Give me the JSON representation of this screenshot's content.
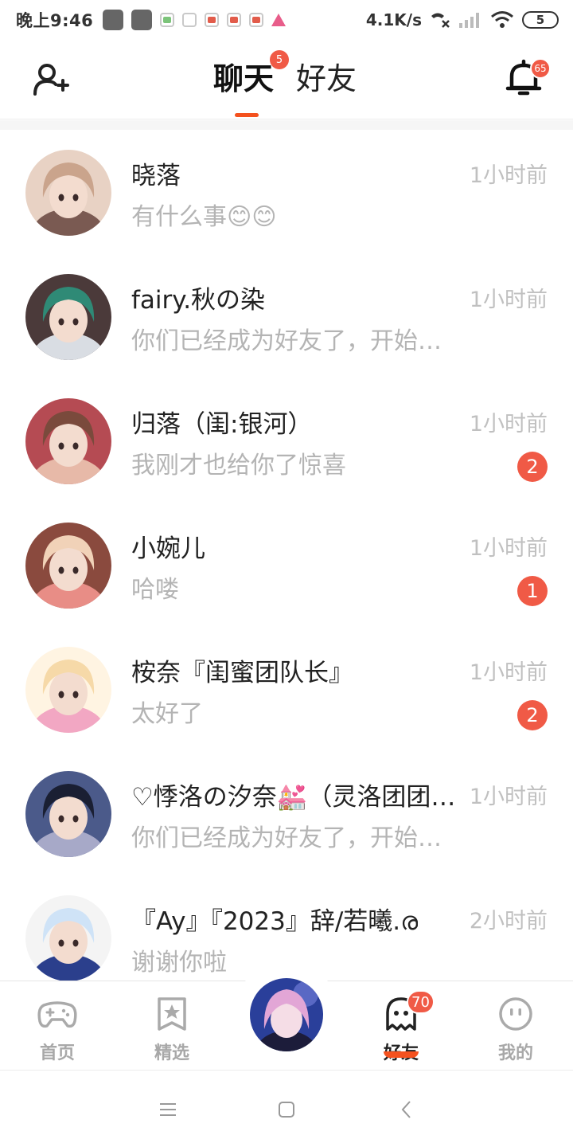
{
  "status_bar": {
    "time": "晚上9:46",
    "net_speed": "4.1K/s",
    "battery": "5"
  },
  "header": {
    "tabs": [
      {
        "label": "聊天",
        "active": true,
        "badge": "5"
      },
      {
        "label": "好友",
        "active": false
      }
    ],
    "bell_badge": "65",
    "add_friend_icon": "add-user-icon",
    "bell_icon": "bell-icon"
  },
  "conversations": [
    {
      "name": "晓落",
      "message": "有什么事😊😊",
      "time": "1小时前",
      "unread": null,
      "avatar_colors": [
        "#caa48c",
        "#7a5a52",
        "#e8d2c4"
      ]
    },
    {
      "name": "fairy.秋の染",
      "message": "你们已经成为好友了，开始聊天吧",
      "time": "1小时前",
      "unread": null,
      "avatar_colors": [
        "#2f8a76",
        "#d9dde3",
        "#4b3a3a"
      ]
    },
    {
      "name": "归落（闺:银河）",
      "message": "我刚才也给你了惊喜",
      "time": "1小时前",
      "unread": "2",
      "avatar_colors": [
        "#7a4a3c",
        "#e7b9a8",
        "#b54b53"
      ]
    },
    {
      "name": "小婉儿",
      "message": "哈喽",
      "time": "1小时前",
      "unread": "1",
      "avatar_colors": [
        "#f1d2b8",
        "#e88d86",
        "#8a4a3e"
      ]
    },
    {
      "name": "桉奈『闺蜜团队长』",
      "message": "太好了",
      "time": "1小时前",
      "unread": "2",
      "avatar_colors": [
        "#f6d9a8",
        "#f2a7c3",
        "#fff4e2"
      ]
    },
    {
      "name": "♡悸洛の汐奈💒（灵洛团团长）",
      "message": "你们已经成为好友了，开始聊天吧",
      "time": "1小时前",
      "unread": null,
      "avatar_colors": [
        "#1a1f33",
        "#a7a9c8",
        "#4b5a8a"
      ]
    },
    {
      "name": "『Ay』『2023』辞/若曦.ര",
      "message": "谢谢你啦",
      "time": "2小时前",
      "unread": null,
      "avatar_colors": [
        "#cfe3f7",
        "#2b3f8c",
        "#f4f4f4"
      ]
    }
  ],
  "bottom_nav": {
    "items": [
      {
        "label": "首页",
        "icon": "gamepad-icon",
        "active": false
      },
      {
        "label": "精选",
        "icon": "star-bookmark-icon",
        "active": false
      },
      {
        "label": "好友",
        "icon": "ghost-icon",
        "active": true,
        "badge": "70"
      },
      {
        "label": "我的",
        "icon": "face-icon",
        "active": false
      }
    ],
    "center_avatar_colors": [
      "#2a3f9a",
      "#e2a6d6",
      "#6d7bd6"
    ]
  },
  "colors": {
    "accent": "#f4511e",
    "badge": "#f05a46",
    "muted_text": "#b4b4b4"
  }
}
